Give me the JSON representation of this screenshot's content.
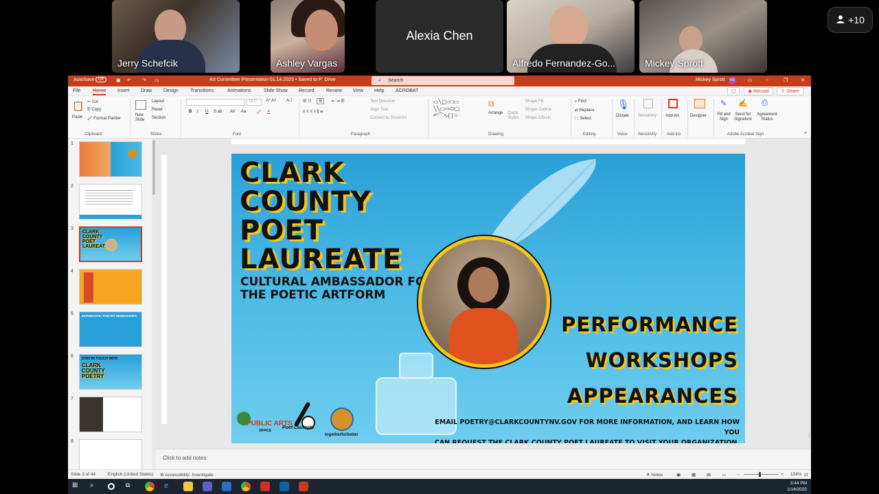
{
  "participants": [
    {
      "name": "Jerry Schefcik"
    },
    {
      "name": "Ashley Vargas"
    },
    {
      "name": "Alexia Chen"
    },
    {
      "name": "Alfredo Fernandez-Go..."
    },
    {
      "name": "Mickey Sprott"
    }
  ],
  "more_participants": "+10",
  "window": {
    "autosave_label": "AutoSave",
    "autosave_state": "Off",
    "doc_title": "Art Committee Presentation 01.14.2025 • Saved to P: Drive",
    "search_placeholder": "Search",
    "user_name": "Mickey Sprott",
    "user_initials": "MS"
  },
  "menu": [
    "File",
    "Home",
    "Insert",
    "Draw",
    "Design",
    "Transitions",
    "Animations",
    "Slide Show",
    "Record",
    "Review",
    "View",
    "Help",
    "ACROBAT"
  ],
  "menu_active": "Home",
  "record_btn": "Record",
  "share_btn": "Share",
  "ribbon": {
    "clipboard": {
      "paste": "Paste",
      "cut": "Cut",
      "copy": "Copy",
      "format_painter": "Format Painter",
      "label": "Clipboard"
    },
    "slides": {
      "new_slide": "New Slide",
      "layout": "Layout",
      "reset": "Reset",
      "section": "Section",
      "label": "Slides"
    },
    "font": {
      "size": "18.0",
      "label": "Font"
    },
    "paragraph": {
      "text_direction": "Text Direction",
      "align_text": "Align Text",
      "convert": "Convert to SmartArt",
      "label": "Paragraph"
    },
    "drawing": {
      "arrange": "Arrange",
      "quick_styles": "Quick Styles",
      "shape_fill": "Shape Fill",
      "shape_outline": "Shape Outline",
      "shape_effects": "Shape Effects",
      "label": "Drawing"
    },
    "editing": {
      "find": "Find",
      "replace": "Replace",
      "select": "Select",
      "label": "Editing"
    },
    "voice": {
      "dictate": "Dictate",
      "label": "Voice"
    },
    "sensitivity": {
      "btn": "Sensitivity",
      "label": "Sensitivity"
    },
    "addins": {
      "btn": "Add-ins",
      "label": "Add-ins"
    },
    "designer": {
      "btn": "Designer"
    },
    "adobe": {
      "fill_sign": "Fill and Sign",
      "send_sign": "Send for Signature",
      "agreement": "Agreement Status",
      "label": "Adobe Acrobat Sign"
    }
  },
  "thumbnails": [
    "1",
    "2",
    "3",
    "4",
    "5",
    "6",
    "7",
    "8"
  ],
  "selected_slide": 3,
  "slide": {
    "title_lines": [
      "CLARK",
      "COUNTY",
      "POET",
      "LAUREATE"
    ],
    "subtitle_lines": [
      "CULTURAL AMBASSADOR FOR",
      "THE POETIC ARTFORM"
    ],
    "offerings": [
      "PERFORMANCE",
      "WORKSHOPS",
      "APPEARANCES"
    ],
    "email_line1": "EMAIL POETRY@CLARKCOUNTYNV.GOV FOR MORE INFORMATION, AND LEARN HOW YOU",
    "email_line2": "CAN REQUEST THE CLARK COUNTY POET LAUREATE TO VISIT YOUR ORGANIZATION.",
    "logo_public_arts": "PUBLIC ARTS",
    "logo_office": "OFFICE",
    "logo_poet": "Poet Laureate",
    "logo_together": "togetherforbetter"
  },
  "thumb_text": {
    "t6_line1": "STAY IN TOUCH WITH",
    "t6_line2": "CLARK COUNTY POETRY",
    "t5_title": "EKPHRASTIC POETRY WORKSHOPS"
  },
  "notes_placeholder": "Click to add notes",
  "status": {
    "slide_count": "Slide 3 of 44",
    "language": "English (United States)",
    "accessibility": "Accessibility: Investigate",
    "notes": "Notes",
    "zoom": "104%"
  },
  "clock": {
    "time": "3:44 PM",
    "date": "1/14/2025"
  },
  "colors": {
    "ppt_red": "#c43e1c",
    "slide_blue": "#2aa0d8",
    "accent_yellow": "#f5c518"
  }
}
